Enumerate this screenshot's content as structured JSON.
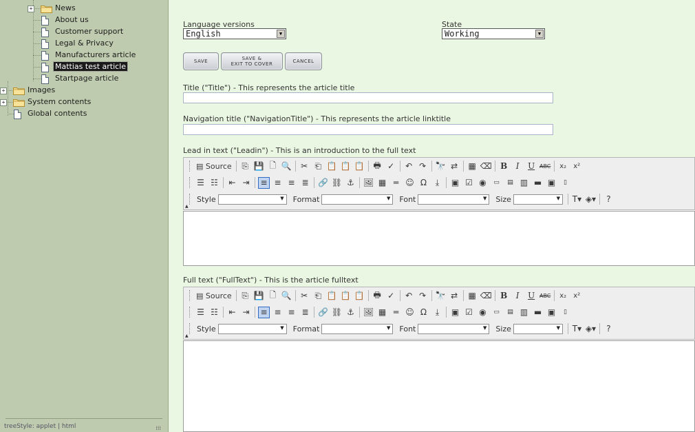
{
  "tree": {
    "items": [
      {
        "label": "News",
        "type": "folder"
      },
      {
        "label": "About us",
        "type": "doc"
      },
      {
        "label": "Customer support",
        "type": "doc"
      },
      {
        "label": "Legal & Privacy",
        "type": "doc"
      },
      {
        "label": "Manufacturers article",
        "type": "doc"
      },
      {
        "label": "Mattias test article",
        "type": "doc",
        "selected": true
      },
      {
        "label": "Startpage article",
        "type": "doc"
      },
      {
        "label": "Images",
        "type": "folder"
      },
      {
        "label": "System contents",
        "type": "folder"
      },
      {
        "label": "Global contents",
        "type": "doc"
      }
    ],
    "footer": "treeStyle: applet | html",
    "expand_symbol": "+",
    "resize_grip": "⁞⁞⁞"
  },
  "form": {
    "language_label": "Language versions",
    "language_value": "English",
    "state_label": "State",
    "state_value": "Working",
    "save_label": "SAVE",
    "save_exit_label_1": "SAVE &",
    "save_exit_label_2": "EXIT TO COVER",
    "cancel_label": "CANCEL",
    "title_label": "Title (\"Title\") - This represents the article title",
    "title_value": "",
    "nav_label": "Navigation title (\"NavigationTitle\") - This represents the article linktitle",
    "nav_value": "",
    "leadin_label": "Lead in text (\"Leadin\") - This is an introduction to the full text",
    "fulltext_label": "Full text (\"FullText\") - This is the article fulltext"
  },
  "toolbar": {
    "source_label": "Source",
    "style_label": "Style",
    "format_label": "Format",
    "font_label": "Font",
    "size_label": "Size",
    "bold": "B",
    "italic": "I",
    "underline": "U",
    "strike": "ABC",
    "subscript": "x₂",
    "superscript": "x²"
  }
}
